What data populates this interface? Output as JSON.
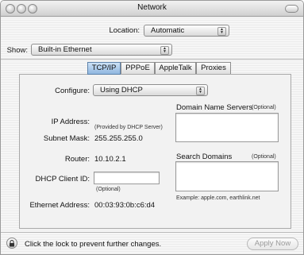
{
  "window": {
    "title": "Network"
  },
  "location": {
    "label": "Location:",
    "value": "Automatic"
  },
  "show": {
    "label": "Show:",
    "value": "Built-in Ethernet"
  },
  "tabs": [
    {
      "label": "TCP/IP"
    },
    {
      "label": "PPPoE"
    },
    {
      "label": "AppleTalk"
    },
    {
      "label": "Proxies"
    }
  ],
  "tcpip": {
    "configure_label": "Configure:",
    "configure_value": "Using DHCP",
    "ip_label": "IP Address:",
    "ip_note": "(Provided by DHCP Server)",
    "subnet_label": "Subnet Mask:",
    "subnet_value": "255.255.255.0",
    "router_label": "Router:",
    "router_value": "10.10.2.1",
    "dhcp_label": "DHCP Client ID:",
    "dhcp_value": "",
    "dhcp_note": "(Optional)",
    "ethernet_label": "Ethernet Address:",
    "ethernet_value": "00:03:93:0b:c6:d4",
    "dns_label": "Domain Name Servers",
    "dns_optional": "(Optional)",
    "search_label": "Search Domains",
    "search_optional": "(Optional)",
    "example_text": "Example: apple.com, earthlink.net"
  },
  "footer": {
    "lock_text": "Click the lock to prevent further changes.",
    "apply_label": "Apply Now"
  }
}
